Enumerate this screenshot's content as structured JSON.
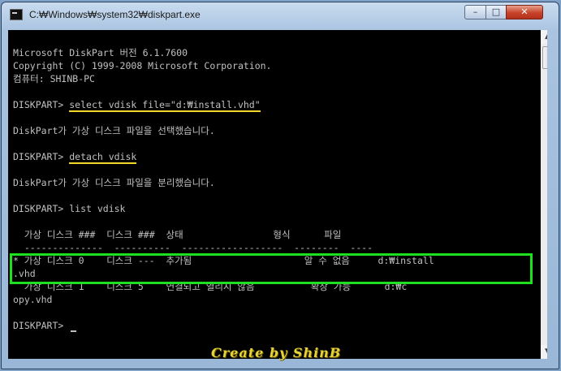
{
  "window": {
    "title": "C:₩Windows₩system32₩diskpart.exe",
    "controls": {
      "minimize": "–",
      "maximize": "□",
      "close": "✕"
    }
  },
  "console": {
    "lines": {
      "header1": "Microsoft DiskPart 버전 6.1.7600",
      "header2": "Copyright (C) 1999-2008 Microsoft Corporation.",
      "header3": "컴퓨터: SHINB-PC",
      "prompt": "DISKPART> ",
      "cmd1": "select vdisk file=\"d:₩install.vhd\"",
      "resp1": "DiskPart가 가상 디스크 파일을 선택했습니다.",
      "cmd2": "detach vdisk",
      "resp2": "DiskPart가 가상 디스크 파일을 분리했습니다.",
      "cmd3": "list vdisk",
      "table_header": "  가상 디스크 ###  디스크 ###  상태                형식      파일",
      "table_rule": "  --------------  ----------  ------------------  --------  ----",
      "row1a": "* 가상 디스크 0    디스크 ---  추가됨                    알 수 없음     d:₩install",
      "row1b": ".vhd",
      "row2a": "  가상 디스크 1    디스크 5    연결되고 열리지 않음          확장 가능      d:₩c",
      "row2b": "opy.vhd",
      "final_prompt": "DISKPART> "
    }
  },
  "signature": "Create by ShinB",
  "colors": {
    "underline": "#f2d62a",
    "highlight_box": "#1ee01e",
    "console_bg": "#000000",
    "console_text": "#c0c0c0"
  }
}
